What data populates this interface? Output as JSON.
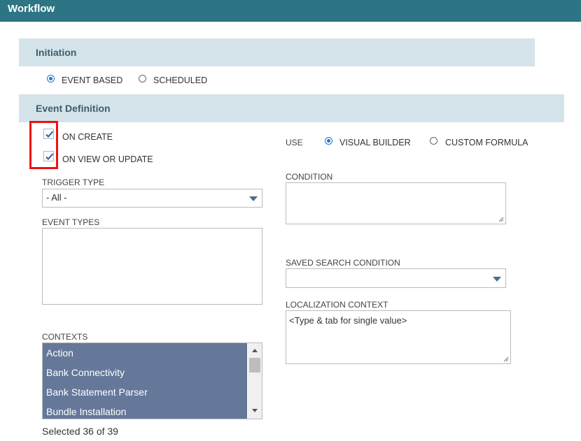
{
  "header": {
    "title": "Workflow"
  },
  "initiation": {
    "title": "Initiation",
    "options": [
      {
        "label": "EVENT BASED",
        "selected": true
      },
      {
        "label": "SCHEDULED",
        "selected": false
      }
    ]
  },
  "event_definition": {
    "title": "Event Definition",
    "checkboxes": [
      {
        "label": "ON CREATE",
        "checked": true
      },
      {
        "label": "ON VIEW OR UPDATE",
        "checked": true
      }
    ],
    "trigger_type": {
      "label": "TRIGGER TYPE",
      "value": "- All -"
    },
    "event_types": {
      "label": "EVENT TYPES"
    },
    "contexts": {
      "label": "CONTEXTS",
      "items": [
        "Action",
        "Bank Connectivity",
        "Bank Statement Parser",
        "Bundle Installation"
      ],
      "selected_text": "Selected 36 of 39"
    },
    "use": {
      "label": "USE",
      "options": [
        {
          "label": "VISUAL BUILDER",
          "selected": true
        },
        {
          "label": "CUSTOM FORMULA",
          "selected": false
        }
      ]
    },
    "condition": {
      "label": "CONDITION"
    },
    "saved_search_condition": {
      "label": "SAVED SEARCH CONDITION",
      "value": ""
    },
    "localization_context": {
      "label": "LOCALIZATION CONTEXT",
      "placeholder": "<Type & tab for single value>"
    }
  },
  "colors": {
    "header": "#2d7585",
    "section": "#d5e3ea",
    "list_selected": "#65789a",
    "highlight": "#ee1111",
    "radio": "#1e73d6"
  }
}
